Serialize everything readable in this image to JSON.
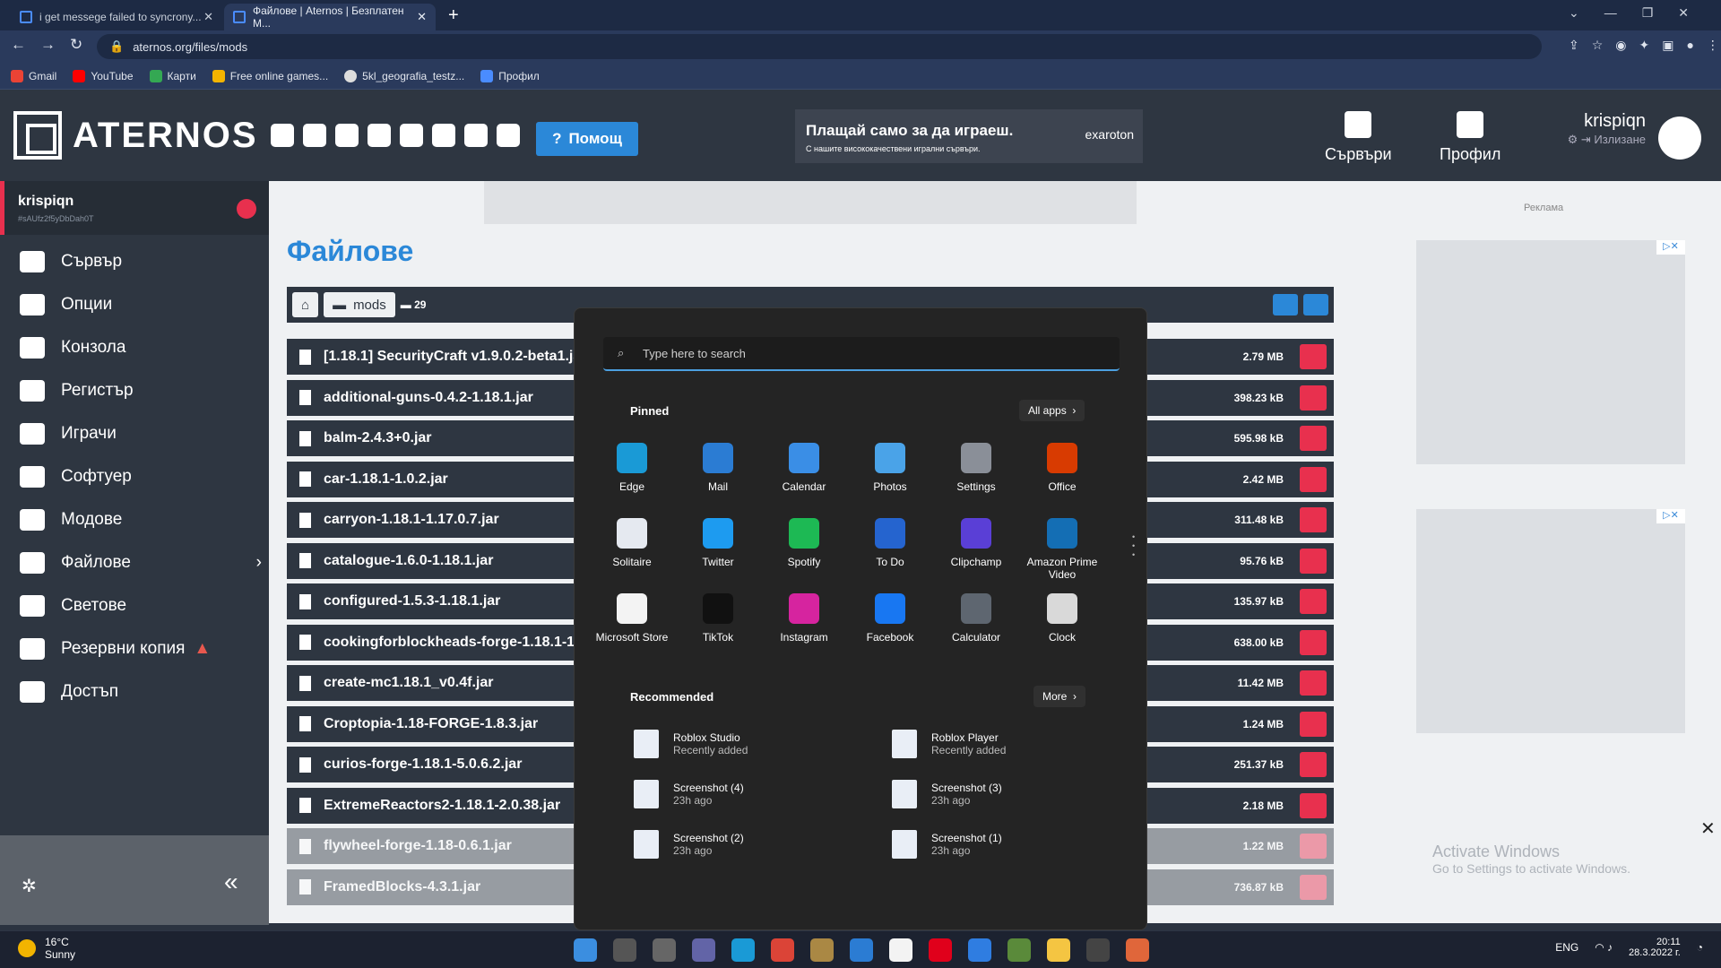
{
  "browser": {
    "tabs": [
      {
        "label": "i get messege failed to syncrony...",
        "active": false
      },
      {
        "label": "Файлове | Aternos | Безплатен M...",
        "active": true
      }
    ],
    "new_tab": "+",
    "url": "aternos.org/files/mods",
    "bookmarks": [
      "Gmail",
      "YouTube",
      "Карти",
      "Free online games...",
      "5kl_geografia_testz...",
      "Профил"
    ]
  },
  "header": {
    "logo": "ATERNOS",
    "help": "Помощ",
    "ad_title": "Плащай само за да играеш.",
    "ad_sub": "С нашите висококачествени игрални сървъри.",
    "ad_brand": "exaroton",
    "nav": [
      "Сървъри",
      "Профил"
    ],
    "username": "krispiqn",
    "logout": "Излизане"
  },
  "sidebar": {
    "server_name": "krispiqn",
    "server_id": "#sAUfz2f5yDbDah0T",
    "items": [
      "Сървър",
      "Опции",
      "Конзола",
      "Регистър",
      "Играчи",
      "Софтуер",
      "Модове",
      "Файлове",
      "Светове",
      "Резервни копия",
      "Достъп"
    ]
  },
  "main": {
    "title": "Файлове",
    "crumb": "mods",
    "count": "29",
    "files": [
      {
        "name": "[1.18.1] SecurityCraft v1.9.0.2-beta1.jar",
        "size": "2.79 MB"
      },
      {
        "name": "additional-guns-0.4.2-1.18.1.jar",
        "size": "398.23 kB"
      },
      {
        "name": "balm-2.4.3+0.jar",
        "size": "595.98 kB"
      },
      {
        "name": "car-1.18.1-1.0.2.jar",
        "size": "2.42 MB"
      },
      {
        "name": "carryon-1.18.1-1.17.0.7.jar",
        "size": "311.48 kB"
      },
      {
        "name": "catalogue-1.6.0-1.18.1.jar",
        "size": "95.76 kB"
      },
      {
        "name": "configured-1.5.3-1.18.1.jar",
        "size": "135.97 kB"
      },
      {
        "name": "cookingforblockheads-forge-1.18.1-11",
        "size": "638.00 kB"
      },
      {
        "name": "create-mc1.18.1_v0.4f.jar",
        "size": "11.42 MB"
      },
      {
        "name": "Croptopia-1.18-FORGE-1.8.3.jar",
        "size": "1.24 MB"
      },
      {
        "name": "curios-forge-1.18.1-5.0.6.2.jar",
        "size": "251.37 kB"
      },
      {
        "name": "ExtremeReactors2-1.18.1-2.0.38.jar",
        "size": "2.18 MB"
      },
      {
        "name": "flywheel-forge-1.18-0.6.1.jar",
        "size": "1.22 MB"
      },
      {
        "name": "FramedBlocks-4.3.1.jar",
        "size": "736.87 kB"
      }
    ]
  },
  "right": {
    "ad_label": "Реклама",
    "activate_title": "Activate Windows",
    "activate_sub": "Go to Settings to activate Windows."
  },
  "start": {
    "search_placeholder": "Type here to search",
    "pinned": "Pinned",
    "all_apps": "All apps",
    "apps": [
      {
        "name": "Edge",
        "color": "#1a9ad6"
      },
      {
        "name": "Mail",
        "color": "#2b7cd3"
      },
      {
        "name": "Calendar",
        "color": "#3a8ee6"
      },
      {
        "name": "Photos",
        "color": "#4aa3e8"
      },
      {
        "name": "Settings",
        "color": "#8a8f98"
      },
      {
        "name": "Office",
        "color": "#d83b01"
      },
      {
        "name": "Solitaire",
        "color": "#e5e9f0"
      },
      {
        "name": "Twitter",
        "color": "#1d9bf0"
      },
      {
        "name": "Spotify",
        "color": "#1db954"
      },
      {
        "name": "To Do",
        "color": "#2564cf"
      },
      {
        "name": "Clipchamp",
        "color": "#5a3fd6"
      },
      {
        "name": "Amazon Prime Video",
        "color": "#146eb4"
      },
      {
        "name": "Microsoft Store",
        "color": "#f3f3f3"
      },
      {
        "name": "TikTok",
        "color": "#111111"
      },
      {
        "name": "Instagram",
        "color": "#d6249f"
      },
      {
        "name": "Facebook",
        "color": "#1877f2"
      },
      {
        "name": "Calculator",
        "color": "#5e6670"
      },
      {
        "name": "Clock",
        "color": "#d9d9d9"
      }
    ],
    "recommended": "Recommended",
    "more": "More",
    "recs": [
      {
        "name": "Roblox Studio",
        "sub": "Recently added"
      },
      {
        "name": "Roblox Player",
        "sub": "Recently added"
      },
      {
        "name": "Screenshot (4)",
        "sub": "23h ago"
      },
      {
        "name": "Screenshot (3)",
        "sub": "23h ago"
      },
      {
        "name": "Screenshot (2)",
        "sub": "23h ago"
      },
      {
        "name": "Screenshot (1)",
        "sub": "23h ago"
      }
    ]
  },
  "taskbar": {
    "temp": "16°C",
    "weather": "Sunny",
    "lang": "ENG",
    "time": "20:11",
    "date": "28.3.2022 г."
  }
}
